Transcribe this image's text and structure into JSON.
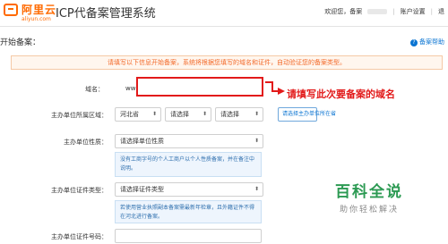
{
  "header": {
    "logo_text": "阿里云",
    "logo_sub": "aliyun.com",
    "system_title": "ICP代备案管理系统",
    "nav_welcome": "欢迎您，备案",
    "nav_account": "账户设置",
    "nav_exit": "退"
  },
  "section": {
    "title": "开始备案：",
    "help": "备案帮助"
  },
  "notice": {
    "text": "请填写以下信息开始备案，系统将根据您填写的域名和证件，自动验证您的备案类型。"
  },
  "form": {
    "domain_label": "域名：",
    "domain_prefix": "www.",
    "domain_value": "",
    "annotation": "请填写此次要备案的域名",
    "region_label": "主办单位所属区域：",
    "province": "河北省",
    "city": "请选择",
    "district": "请选择",
    "region_button": "请选择主办单位所在省",
    "nature_label": "主办单位性质：",
    "nature_select": "请选择单位性质",
    "nature_info": "没有工商字号的个人工商户以个人性质备案，并在备注中说明。",
    "cert_type_label": "主办单位证件类型：",
    "cert_type_select": "请选择证件类型",
    "cert_info": "若使用营业执照副本备案需最新年检章，且外籍证件不得在河北进行备案。",
    "cert_number_label": "主办单位证件号码："
  },
  "watermark": {
    "main": "百科全说",
    "sub": "助你轻松解决"
  }
}
